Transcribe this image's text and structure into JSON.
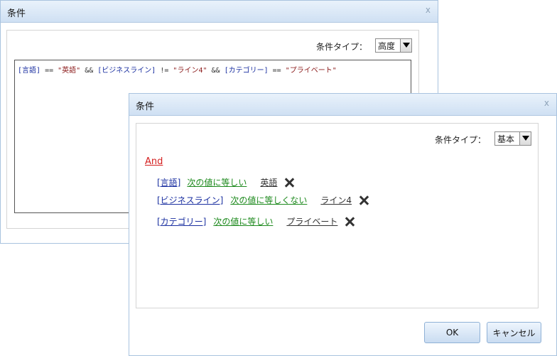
{
  "back_dialog": {
    "title": "条件",
    "close": "x",
    "type_label": "条件タイプ：",
    "type_value": "高度",
    "expression": {
      "f1": "[言語]",
      "op1": " == ",
      "s1": "\"英語\"",
      "and1": " && ",
      "f2": "[ビジネスライン]",
      "op2": " != ",
      "s2": "\"ライン4\"",
      "and2": " && ",
      "f3": "[カテゴリー]",
      "op3": " == ",
      "s3": "\"プライベート\""
    }
  },
  "front_dialog": {
    "title": "条件",
    "close": "x",
    "type_label": "条件タイプ：",
    "type_value": "基本",
    "group_operator": "And",
    "conditions": [
      {
        "field": "[言語]",
        "operator": "次の値に等しい",
        "value": "英語"
      },
      {
        "field": "[ビジネスライン]",
        "operator": "次の値に等しくない",
        "value": "ライン4"
      },
      {
        "field": "[カテゴリー]",
        "operator": "次の値に等しい",
        "value": "プライベート"
      }
    ],
    "ok_label": "OK",
    "cancel_label": "キャンセル"
  }
}
